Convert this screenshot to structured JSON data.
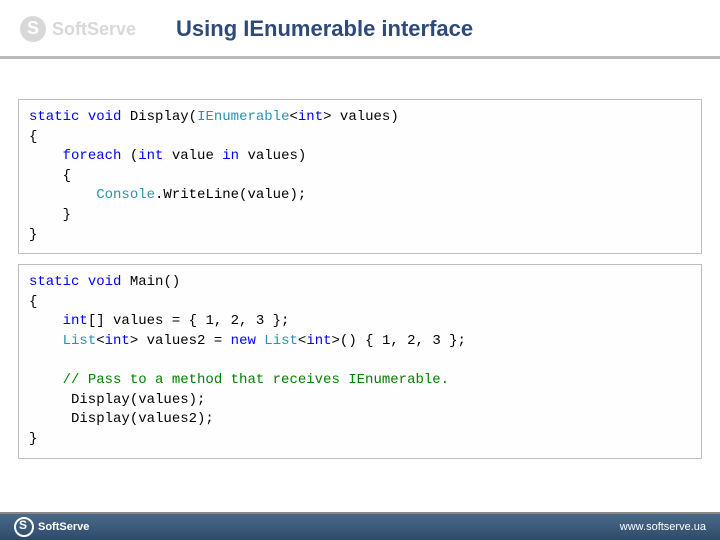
{
  "header": {
    "brand": "SoftServe",
    "title": "Using IEnumerable interface"
  },
  "code1": {
    "tokens": [
      {
        "t": "static",
        "c": "kw"
      },
      {
        "t": " "
      },
      {
        "t": "void",
        "c": "kw"
      },
      {
        "t": " Display("
      },
      {
        "t": "IEnumerable",
        "c": "tp"
      },
      {
        "t": "<"
      },
      {
        "t": "int",
        "c": "kw"
      },
      {
        "t": "> values)\n{\n    "
      },
      {
        "t": "foreach",
        "c": "kw"
      },
      {
        "t": " ("
      },
      {
        "t": "int",
        "c": "kw"
      },
      {
        "t": " value "
      },
      {
        "t": "in",
        "c": "kw"
      },
      {
        "t": " values)\n    {\n        "
      },
      {
        "t": "Console",
        "c": "tp"
      },
      {
        "t": ".WriteLine(value);\n    }\n}"
      }
    ]
  },
  "code2": {
    "tokens": [
      {
        "t": "static",
        "c": "kw"
      },
      {
        "t": " "
      },
      {
        "t": "void",
        "c": "kw"
      },
      {
        "t": " Main()\n{\n    "
      },
      {
        "t": "int",
        "c": "kw"
      },
      {
        "t": "[] values = { 1, 2, 3 };\n    "
      },
      {
        "t": "List",
        "c": "tp"
      },
      {
        "t": "<"
      },
      {
        "t": "int",
        "c": "kw"
      },
      {
        "t": "> values2 = "
      },
      {
        "t": "new",
        "c": "kw"
      },
      {
        "t": " "
      },
      {
        "t": "List",
        "c": "tp"
      },
      {
        "t": "<"
      },
      {
        "t": "int",
        "c": "kw"
      },
      {
        "t": ">() { 1, 2, 3 };\n\n    "
      },
      {
        "t": "// Pass to a method that receives IEnumerable.",
        "c": "cm"
      },
      {
        "t": "\n     Display(values);\n     Display(values2);\n}"
      }
    ]
  },
  "footer": {
    "brand": "SoftServe",
    "url": "www.softserve.ua"
  }
}
